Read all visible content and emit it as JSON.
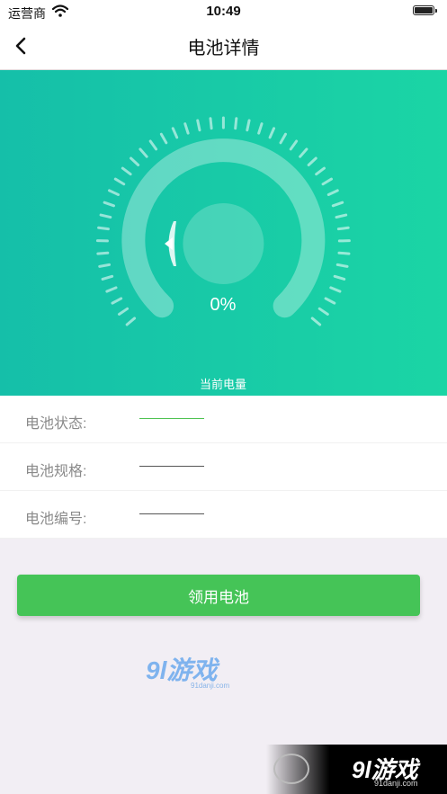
{
  "status_bar": {
    "carrier": "运营商",
    "time": "10:49"
  },
  "nav": {
    "title": "电池详情"
  },
  "gauge": {
    "percent_text": "0%",
    "label": "当前电量",
    "level": 0
  },
  "info": [
    {
      "label": "电池状态:",
      "value_color": "#4cc24f"
    },
    {
      "label": "电池规格:",
      "value_color": "#555555"
    },
    {
      "label": "电池编号:",
      "value_color": "#555555"
    }
  ],
  "claim_button": {
    "label": "领用电池"
  },
  "watermark": {
    "logo": "9l游戏",
    "site": "91danji.com"
  },
  "colors": {
    "accent": "#45c457",
    "hero_start": "#15bfa9",
    "hero_end": "#1bd5a5"
  }
}
